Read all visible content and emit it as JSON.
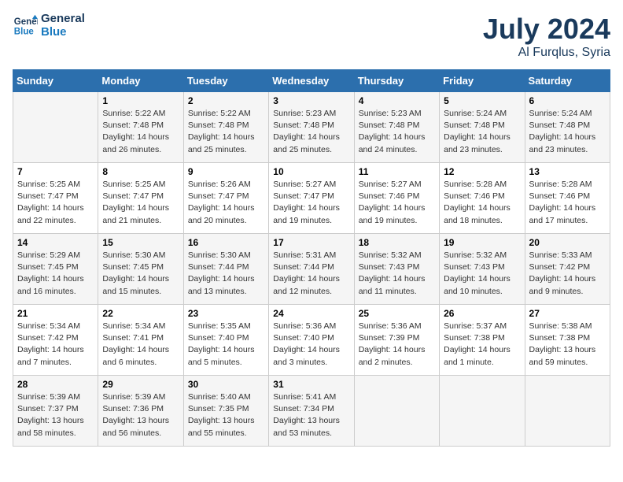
{
  "logo": {
    "line1": "General",
    "line2": "Blue"
  },
  "title": "July 2024",
  "location": "Al Furqlus, Syria",
  "days_header": [
    "Sunday",
    "Monday",
    "Tuesday",
    "Wednesday",
    "Thursday",
    "Friday",
    "Saturday"
  ],
  "weeks": [
    [
      {
        "day": "",
        "info": ""
      },
      {
        "day": "1",
        "info": "Sunrise: 5:22 AM\nSunset: 7:48 PM\nDaylight: 14 hours\nand 26 minutes."
      },
      {
        "day": "2",
        "info": "Sunrise: 5:22 AM\nSunset: 7:48 PM\nDaylight: 14 hours\nand 25 minutes."
      },
      {
        "day": "3",
        "info": "Sunrise: 5:23 AM\nSunset: 7:48 PM\nDaylight: 14 hours\nand 25 minutes."
      },
      {
        "day": "4",
        "info": "Sunrise: 5:23 AM\nSunset: 7:48 PM\nDaylight: 14 hours\nand 24 minutes."
      },
      {
        "day": "5",
        "info": "Sunrise: 5:24 AM\nSunset: 7:48 PM\nDaylight: 14 hours\nand 23 minutes."
      },
      {
        "day": "6",
        "info": "Sunrise: 5:24 AM\nSunset: 7:48 PM\nDaylight: 14 hours\nand 23 minutes."
      }
    ],
    [
      {
        "day": "7",
        "info": "Sunrise: 5:25 AM\nSunset: 7:47 PM\nDaylight: 14 hours\nand 22 minutes."
      },
      {
        "day": "8",
        "info": "Sunrise: 5:25 AM\nSunset: 7:47 PM\nDaylight: 14 hours\nand 21 minutes."
      },
      {
        "day": "9",
        "info": "Sunrise: 5:26 AM\nSunset: 7:47 PM\nDaylight: 14 hours\nand 20 minutes."
      },
      {
        "day": "10",
        "info": "Sunrise: 5:27 AM\nSunset: 7:47 PM\nDaylight: 14 hours\nand 19 minutes."
      },
      {
        "day": "11",
        "info": "Sunrise: 5:27 AM\nSunset: 7:46 PM\nDaylight: 14 hours\nand 19 minutes."
      },
      {
        "day": "12",
        "info": "Sunrise: 5:28 AM\nSunset: 7:46 PM\nDaylight: 14 hours\nand 18 minutes."
      },
      {
        "day": "13",
        "info": "Sunrise: 5:28 AM\nSunset: 7:46 PM\nDaylight: 14 hours\nand 17 minutes."
      }
    ],
    [
      {
        "day": "14",
        "info": "Sunrise: 5:29 AM\nSunset: 7:45 PM\nDaylight: 14 hours\nand 16 minutes."
      },
      {
        "day": "15",
        "info": "Sunrise: 5:30 AM\nSunset: 7:45 PM\nDaylight: 14 hours\nand 15 minutes."
      },
      {
        "day": "16",
        "info": "Sunrise: 5:30 AM\nSunset: 7:44 PM\nDaylight: 14 hours\nand 13 minutes."
      },
      {
        "day": "17",
        "info": "Sunrise: 5:31 AM\nSunset: 7:44 PM\nDaylight: 14 hours\nand 12 minutes."
      },
      {
        "day": "18",
        "info": "Sunrise: 5:32 AM\nSunset: 7:43 PM\nDaylight: 14 hours\nand 11 minutes."
      },
      {
        "day": "19",
        "info": "Sunrise: 5:32 AM\nSunset: 7:43 PM\nDaylight: 14 hours\nand 10 minutes."
      },
      {
        "day": "20",
        "info": "Sunrise: 5:33 AM\nSunset: 7:42 PM\nDaylight: 14 hours\nand 9 minutes."
      }
    ],
    [
      {
        "day": "21",
        "info": "Sunrise: 5:34 AM\nSunset: 7:42 PM\nDaylight: 14 hours\nand 7 minutes."
      },
      {
        "day": "22",
        "info": "Sunrise: 5:34 AM\nSunset: 7:41 PM\nDaylight: 14 hours\nand 6 minutes."
      },
      {
        "day": "23",
        "info": "Sunrise: 5:35 AM\nSunset: 7:40 PM\nDaylight: 14 hours\nand 5 minutes."
      },
      {
        "day": "24",
        "info": "Sunrise: 5:36 AM\nSunset: 7:40 PM\nDaylight: 14 hours\nand 3 minutes."
      },
      {
        "day": "25",
        "info": "Sunrise: 5:36 AM\nSunset: 7:39 PM\nDaylight: 14 hours\nand 2 minutes."
      },
      {
        "day": "26",
        "info": "Sunrise: 5:37 AM\nSunset: 7:38 PM\nDaylight: 14 hours\nand 1 minute."
      },
      {
        "day": "27",
        "info": "Sunrise: 5:38 AM\nSunset: 7:38 PM\nDaylight: 13 hours\nand 59 minutes."
      }
    ],
    [
      {
        "day": "28",
        "info": "Sunrise: 5:39 AM\nSunset: 7:37 PM\nDaylight: 13 hours\nand 58 minutes."
      },
      {
        "day": "29",
        "info": "Sunrise: 5:39 AM\nSunset: 7:36 PM\nDaylight: 13 hours\nand 56 minutes."
      },
      {
        "day": "30",
        "info": "Sunrise: 5:40 AM\nSunset: 7:35 PM\nDaylight: 13 hours\nand 55 minutes."
      },
      {
        "day": "31",
        "info": "Sunrise: 5:41 AM\nSunset: 7:34 PM\nDaylight: 13 hours\nand 53 minutes."
      },
      {
        "day": "",
        "info": ""
      },
      {
        "day": "",
        "info": ""
      },
      {
        "day": "",
        "info": ""
      }
    ]
  ]
}
